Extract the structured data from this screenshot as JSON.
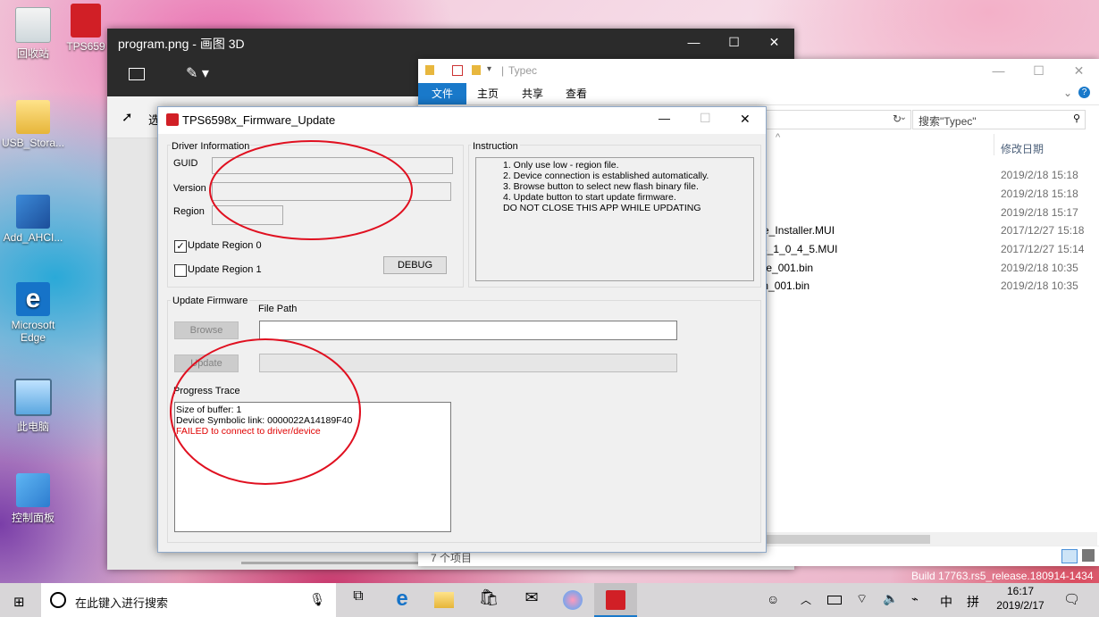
{
  "desktop": {
    "icons": [
      {
        "label": "回收站"
      },
      {
        "label": "TPS659"
      },
      {
        "label": "USB_Stora..."
      },
      {
        "label": "Add_AHCI..."
      },
      {
        "label": "Microsoft Edge"
      },
      {
        "label": "此电脑"
      },
      {
        "label": "控制面板"
      }
    ],
    "build_text": "Build 17763.rs5_release.180914-1434"
  },
  "paint3d": {
    "title": "program.png - 画图 3D",
    "select_label": "选"
  },
  "explorer": {
    "title": "Typec",
    "tabs": [
      "文件",
      "主页",
      "共享",
      "查看"
    ],
    "search_placeholder": "搜索\"Typec\"",
    "date_header": "修改日期",
    "files": [
      {
        "name": "",
        "date": "2019/2/18 15:18"
      },
      {
        "name": "",
        "date": "2019/2/18 15:18"
      },
      {
        "name": "",
        "date": "2019/2/18 15:17"
      },
      {
        "name": "ate_Installer.MUI",
        "date": "2017/12/27 15:18"
      },
      {
        "name": "S3_1_0_4_5.MUI",
        "date": "2017/12/27 15:14"
      },
      {
        "name": "age_001.bin",
        "date": "2019/2/18 10:35"
      },
      {
        "name": "ion_001.bin",
        "date": "2019/2/18 10:35"
      }
    ],
    "status": "7 个项目"
  },
  "dialog": {
    "title": "TPS6598x_Firmware_Update",
    "driver_info": {
      "group_label": "Driver Information",
      "guid_label": "GUID",
      "version_label": "Version",
      "region_label": "Region",
      "guid_value": "",
      "version_value": "",
      "region_value": "",
      "update_region0": {
        "label": "Update Region 0",
        "checked": true
      },
      "update_region1": {
        "label": "Update Region 1",
        "checked": false
      },
      "debug_label": "DEBUG"
    },
    "instruction": {
      "group_label": "Instruction",
      "lines": [
        "1. Only use low - region file.",
        "2. Device connection is established automatically.",
        "3. Browse button to select new flash binary file.",
        "4. Update button to start update firmware.",
        "DO NOT CLOSE THIS APP WHILE UPDATING"
      ]
    },
    "update_firmware": {
      "group_label": "Update Firmware",
      "file_path_label": "File Path",
      "browse_label": "Browse",
      "update_label": "Update",
      "file_path_value": ""
    },
    "progress": {
      "label": "Progress Trace",
      "lines": [
        {
          "text": "Size of buffer: 1",
          "color": "#000000"
        },
        {
          "text": "Device Symbolic link: 0000022A14189F40",
          "color": "#000000"
        },
        {
          "text": "FAILED to connect to driver/device",
          "color": "#e00000"
        }
      ]
    }
  },
  "taskbar": {
    "search_placeholder": "在此键入进行搜索",
    "ime_mode": "中",
    "ime_layout": "拼",
    "time": "16:17",
    "date": "2019/2/17"
  },
  "colors": {
    "annotation_red": "#e01020",
    "explorer_file_tab": "#1979ca"
  }
}
